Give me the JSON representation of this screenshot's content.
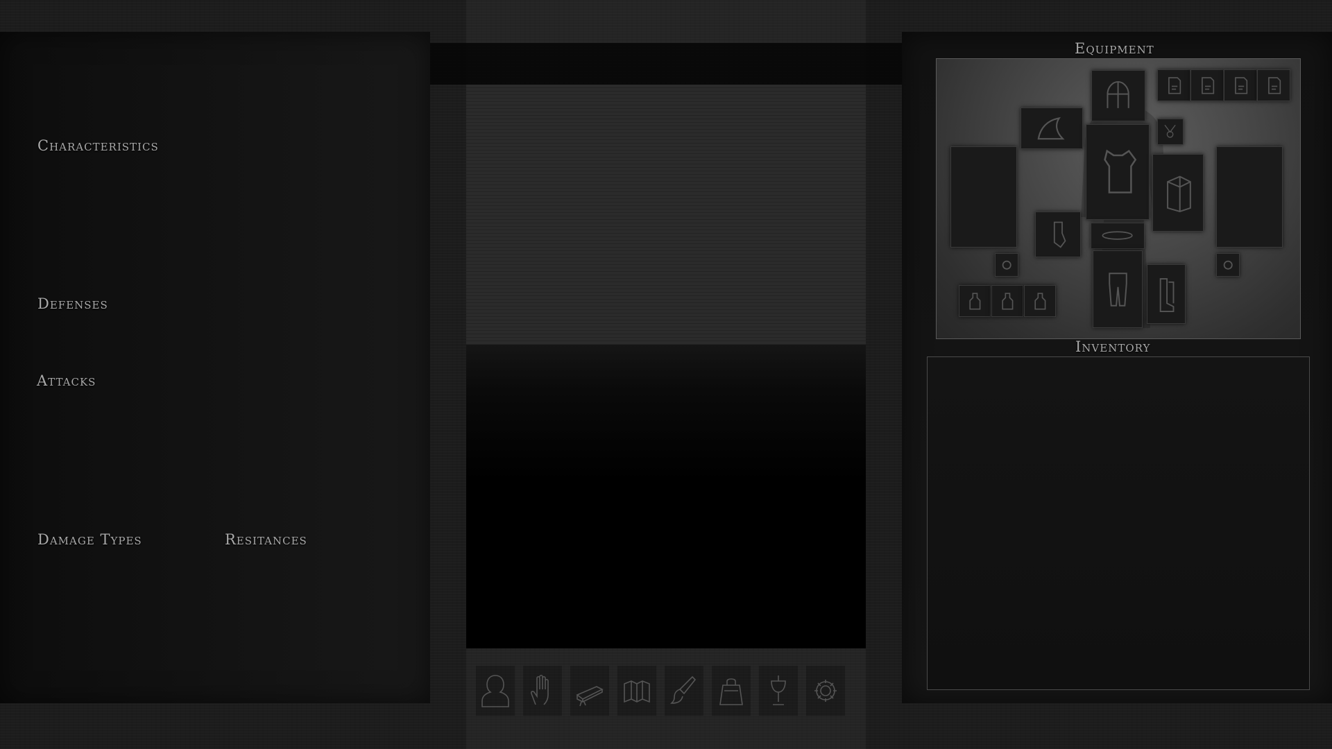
{
  "left_panel": {
    "characteristics": "Characteristics",
    "defenses": "Defenses",
    "attacks": "Attacks",
    "damage_types": "Damage Types",
    "resitances": "Resitances"
  },
  "right_panel": {
    "equipment_title": "Equipment",
    "inventory_title": "Inventory"
  },
  "equipment_slots": [
    "helmet",
    "scroll-1",
    "scroll-2",
    "scroll-3",
    "scroll-4",
    "cloak",
    "amulet",
    "chest-armor",
    "main-hand",
    "off-hand",
    "shield-pack",
    "gloves",
    "belt",
    "ring-left",
    "ring-right",
    "legs",
    "boots",
    "potion-1",
    "potion-2",
    "potion-3"
  ],
  "toolbar": [
    {
      "name": "character",
      "icon": "head-silhouette-icon"
    },
    {
      "name": "abilities",
      "icon": "hand-icon"
    },
    {
      "name": "spellbook",
      "icon": "book-icon"
    },
    {
      "name": "map",
      "icon": "map-icon"
    },
    {
      "name": "skills",
      "icon": "brush-icon"
    },
    {
      "name": "crafting",
      "icon": "bag-icon"
    },
    {
      "name": "alchemy",
      "icon": "goblet-icon"
    },
    {
      "name": "settings",
      "icon": "gear-icon"
    }
  ]
}
